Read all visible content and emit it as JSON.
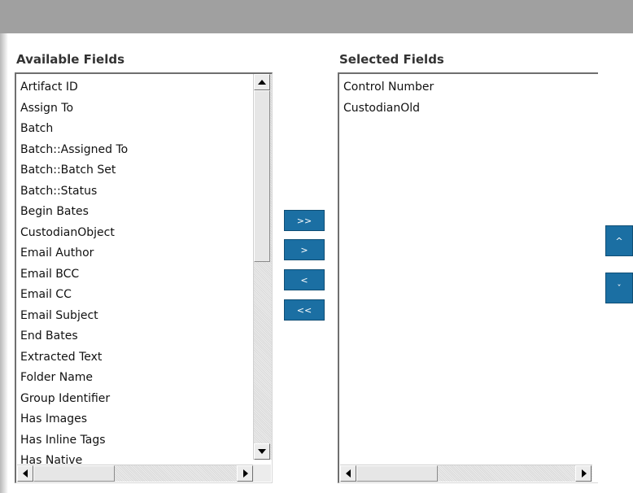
{
  "available": {
    "title": "Available Fields",
    "items": [
      "Artifact ID",
      "Assign To",
      "Batch",
      "Batch::Assigned To",
      "Batch::Batch Set",
      "Batch::Status",
      "Begin Bates",
      "CustodianObject",
      "Email Author",
      "Email BCC",
      "Email CC",
      "Email Subject",
      "End Bates",
      "Extracted Text",
      "Folder Name",
      "Group Identifier",
      "Has Images",
      "Has Inline Tags",
      "Has Native"
    ]
  },
  "selected": {
    "title": "Selected Fields",
    "items": [
      "Control Number",
      "CustodianOld"
    ]
  },
  "transfer": {
    "add_all": ">>",
    "add": ">",
    "remove": "<",
    "remove_all": "<<"
  },
  "order": {
    "move_up": "^",
    "move_down": "ˇ"
  },
  "colors": {
    "button_bg": "#1b6fa3",
    "header_bar": "#a0a0a0"
  }
}
